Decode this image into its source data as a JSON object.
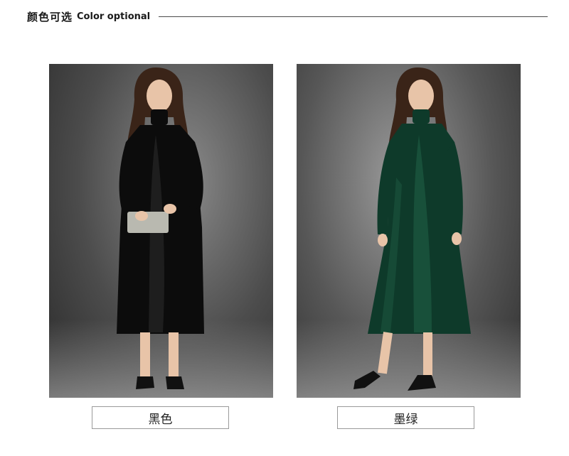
{
  "header": {
    "title_cn": "颜色可选",
    "title_en": "Color optional"
  },
  "variants": [
    {
      "label": "黑色",
      "dress_color": "#0c0c0c",
      "highlight": "#2b2b2b"
    },
    {
      "label": "墨绿",
      "dress_color": "#0e3a2a",
      "highlight": "#1d5a42"
    }
  ],
  "colors": {
    "skin": "#e8c4a8",
    "hair": "#3a2418",
    "shoes": "#111111",
    "clutch": "#b9b9b0"
  }
}
